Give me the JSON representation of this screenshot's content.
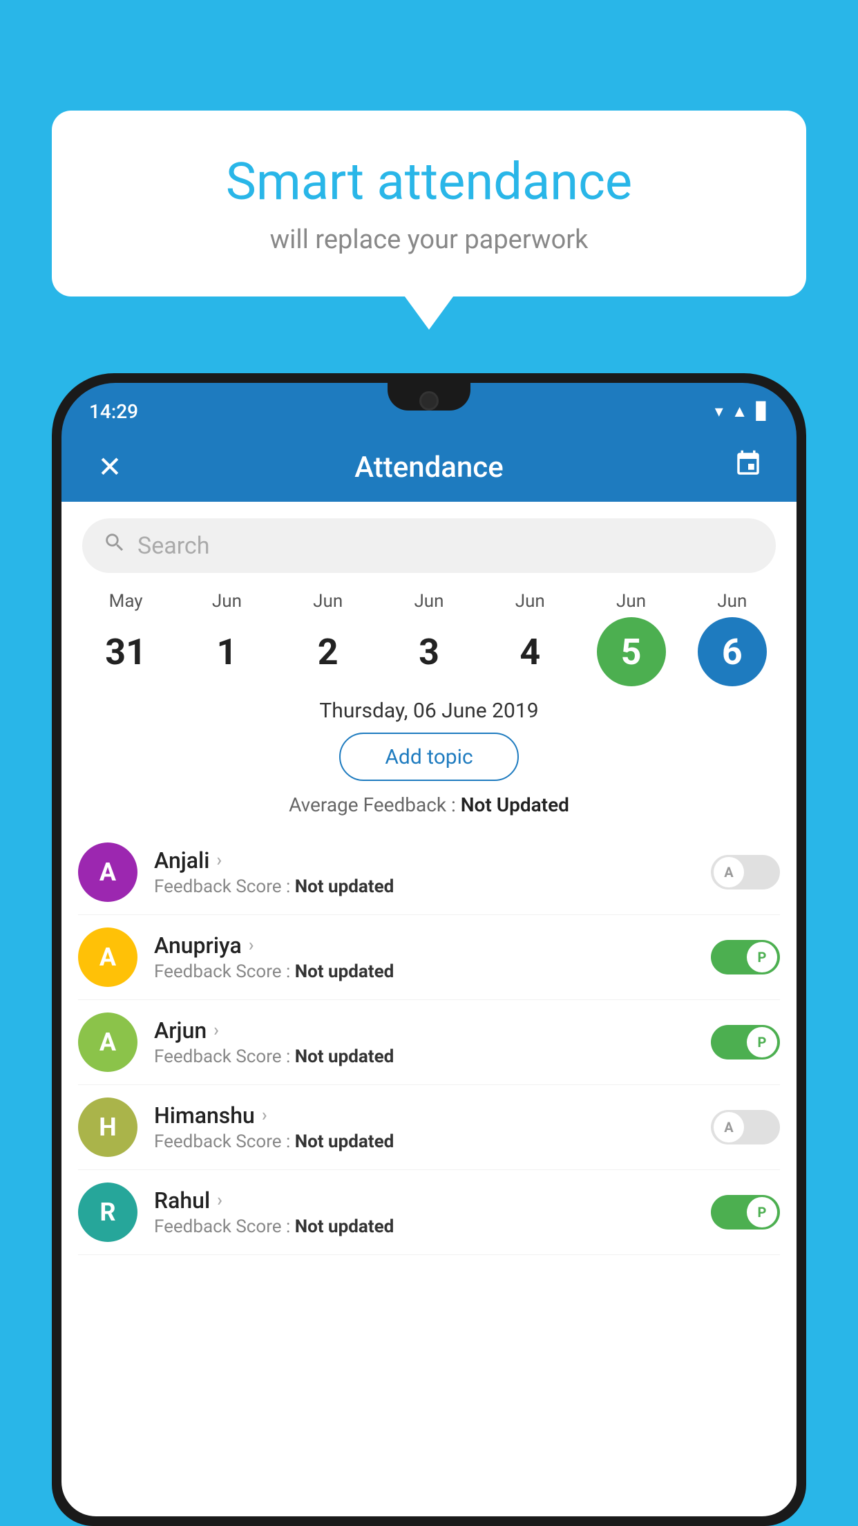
{
  "background_color": "#29b6e8",
  "speech_bubble": {
    "title": "Smart attendance",
    "subtitle": "will replace your paperwork"
  },
  "status_bar": {
    "time": "14:29",
    "wifi_icon": "▲",
    "signal_icon": "▲",
    "battery_icon": "▊"
  },
  "app_bar": {
    "title": "Attendance",
    "close_label": "✕",
    "calendar_label": "📅"
  },
  "search": {
    "placeholder": "Search"
  },
  "calendar": {
    "days": [
      {
        "month": "May",
        "date": "31",
        "state": "normal"
      },
      {
        "month": "Jun",
        "date": "1",
        "state": "normal"
      },
      {
        "month": "Jun",
        "date": "2",
        "state": "normal"
      },
      {
        "month": "Jun",
        "date": "3",
        "state": "normal"
      },
      {
        "month": "Jun",
        "date": "4",
        "state": "normal"
      },
      {
        "month": "Jun",
        "date": "5",
        "state": "today"
      },
      {
        "month": "Jun",
        "date": "6",
        "state": "selected"
      }
    ]
  },
  "selected_date": "Thursday, 06 June 2019",
  "add_topic_label": "Add topic",
  "average_feedback": {
    "label": "Average Feedback : ",
    "value": "Not Updated"
  },
  "students": [
    {
      "name": "Anjali",
      "avatar_letter": "A",
      "avatar_color": "purple",
      "feedback_label": "Feedback Score : ",
      "feedback_value": "Not updated",
      "toggle": "off",
      "toggle_letter": "A"
    },
    {
      "name": "Anupriya",
      "avatar_letter": "A",
      "avatar_color": "yellow",
      "feedback_label": "Feedback Score : ",
      "feedback_value": "Not updated",
      "toggle": "on",
      "toggle_letter": "P"
    },
    {
      "name": "Arjun",
      "avatar_letter": "A",
      "avatar_color": "light-green",
      "feedback_label": "Feedback Score : ",
      "feedback_value": "Not updated",
      "toggle": "on",
      "toggle_letter": "P"
    },
    {
      "name": "Himanshu",
      "avatar_letter": "H",
      "avatar_color": "olive",
      "feedback_label": "Feedback Score : ",
      "feedback_value": "Not updated",
      "toggle": "off",
      "toggle_letter": "A"
    },
    {
      "name": "Rahul",
      "avatar_letter": "R",
      "avatar_color": "teal",
      "feedback_label": "Feedback Score : ",
      "feedback_value": "Not updated",
      "toggle": "on",
      "toggle_letter": "P"
    }
  ]
}
